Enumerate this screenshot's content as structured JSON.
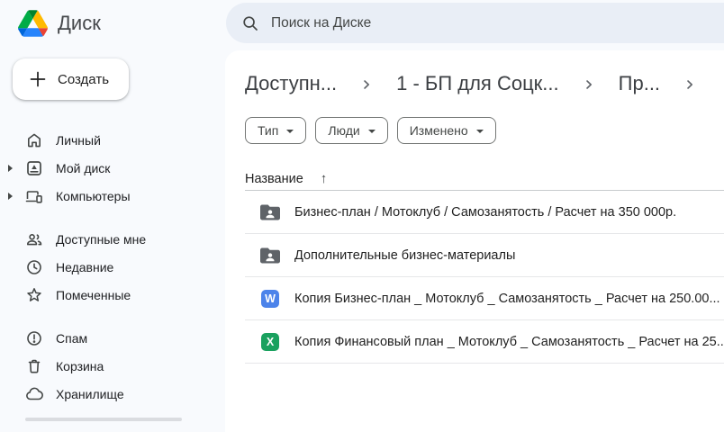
{
  "header": {
    "app_name": "Диск",
    "search_placeholder": "Поиск на Диске"
  },
  "sidebar": {
    "create_label": "Создать",
    "groups": [
      {
        "items": [
          {
            "label": "Личный",
            "icon": "home",
            "expandable": false
          },
          {
            "label": "Мой диск",
            "icon": "my-drive",
            "expandable": true
          },
          {
            "label": "Компьютеры",
            "icon": "computers",
            "expandable": true
          }
        ]
      },
      {
        "items": [
          {
            "label": "Доступные мне",
            "icon": "people",
            "expandable": false
          },
          {
            "label": "Недавние",
            "icon": "clock",
            "expandable": false
          },
          {
            "label": "Помеченные",
            "icon": "star",
            "expandable": false
          }
        ]
      },
      {
        "items": [
          {
            "label": "Спам",
            "icon": "spam",
            "expandable": false
          },
          {
            "label": "Корзина",
            "icon": "trash",
            "expandable": false
          },
          {
            "label": "Хранилище",
            "icon": "cloud",
            "expandable": false
          }
        ]
      }
    ]
  },
  "breadcrumbs": {
    "items": [
      "Доступн...",
      "1 - БП для Соцк...",
      "Пр..."
    ]
  },
  "filters": {
    "chips": [
      "Тип",
      "Люди",
      "Изменено"
    ]
  },
  "table": {
    "name_column": "Название",
    "sort_icon": "↑",
    "sort_direction": "ascending"
  },
  "files": {
    "rows": [
      {
        "type": "shared-folder",
        "name": "Бизнес-план / Мотоклуб / Самозанятость / Расчет на 350 000р."
      },
      {
        "type": "shared-folder",
        "name": "Дополнительные бизнес-материалы"
      },
      {
        "type": "word-document",
        "badge_letter": "W",
        "name": "Копия Бизнес-план _ Мотоклуб _ Самозанятость _ Расчет на 250.00..."
      },
      {
        "type": "excel-spreadsheet",
        "badge_letter": "X",
        "name": "Копия Финансовый план _ Мотоклуб _ Самозанятость _ Расчет на 25..."
      }
    ]
  },
  "colors": {
    "page_bg": "#F8FAFD",
    "search_bg": "#E9EEF6",
    "word_badge": "#4C83EA",
    "excel_badge": "#1AA15F",
    "shared_folder": "#5F6368"
  }
}
